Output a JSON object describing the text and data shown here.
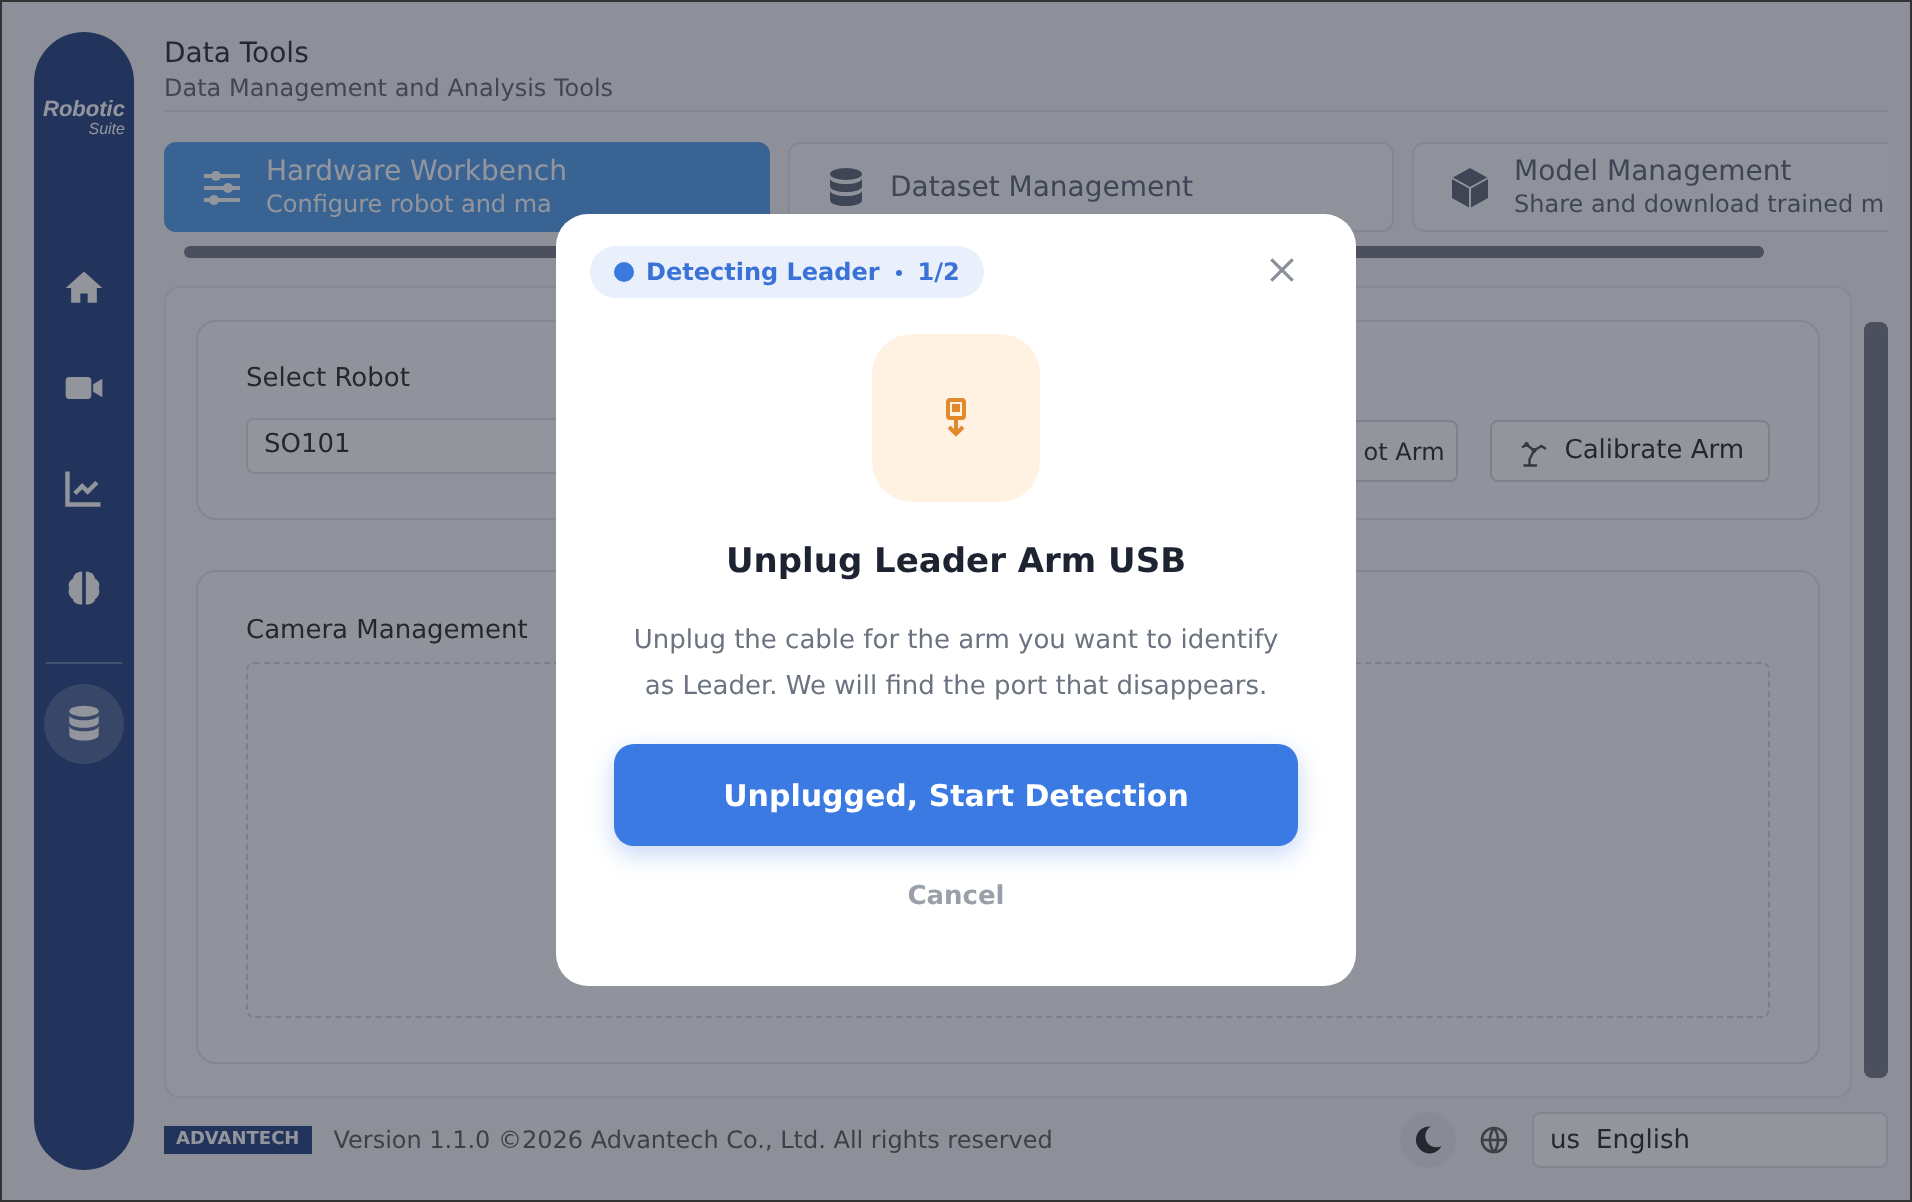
{
  "sidebar": {
    "logo": {
      "line1": "Robotic",
      "line2": "Suite"
    },
    "items": [
      {
        "kind": "home",
        "selected": false
      },
      {
        "kind": "video",
        "selected": false
      },
      {
        "kind": "chart",
        "selected": false
      },
      {
        "kind": "brain",
        "selected": false
      },
      {
        "kind": "database",
        "selected": true
      }
    ]
  },
  "header": {
    "title": "Data Tools",
    "subtitle": "Data Management and Analysis Tools"
  },
  "tabs": [
    {
      "kind": "sliders",
      "title": "Hardware Workbench",
      "subtitle": "Configure robot and ma",
      "selected": true
    },
    {
      "kind": "database",
      "title": "Dataset Management",
      "selected": false
    },
    {
      "kind": "cube",
      "title": "Model Management",
      "subtitle": "Share and download trained m",
      "selected": false
    }
  ],
  "robot_card": {
    "label": "Select Robot",
    "value": "SO101",
    "buttons": [
      {
        "kind": "plain",
        "label": "ot Arm"
      },
      {
        "kind": "arm",
        "label": "Calibrate Arm"
      }
    ]
  },
  "camera_card": {
    "title": "Camera Management"
  },
  "footer": {
    "brand": "ADVANTECH",
    "version": "Version 1.1.0 ©2026 Advantech Co., Ltd. All rights reserved",
    "language_code": "us",
    "language": "English"
  },
  "dialog": {
    "badge": "Detecting Leader",
    "step": "1/2",
    "title": "Unplug Leader Arm USB",
    "message": "Unplug the cable for the arm you want to identify as Leader. We will find the port that disappears.",
    "primary": "Unplugged, Start Detection",
    "cancel": "Cancel"
  }
}
